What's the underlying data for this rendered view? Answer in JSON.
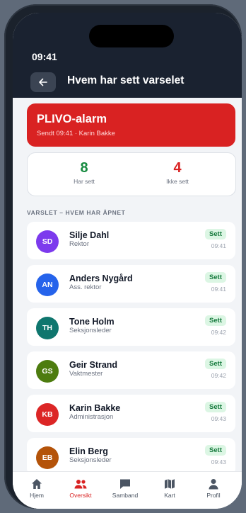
{
  "status_bar": {
    "time": "09:41"
  },
  "header": {
    "title": "Hvem har sett varselet"
  },
  "alarm": {
    "title": "PLIVO-alarm",
    "subtitle": "Sendt 09:41 · Karin Bakke"
  },
  "stats": {
    "seen": {
      "count": "8",
      "label": "Har sett",
      "color": "#168a3f"
    },
    "unseen": {
      "count": "4",
      "label": "Ikke sett",
      "color": "#d92222"
    }
  },
  "section": {
    "label": "VARSLET – HVEM HAR ÅPNET"
  },
  "recipients": [
    {
      "initials": "SD",
      "name": "Silje Dahl",
      "role": "Rektor",
      "status": "Sett",
      "time": "09:41",
      "color": "#7c3aed"
    },
    {
      "initials": "AN",
      "name": "Anders Nygård",
      "role": "Ass. rektor",
      "status": "Sett",
      "time": "09:41",
      "color": "#2563eb"
    },
    {
      "initials": "TH",
      "name": "Tone Holm",
      "role": "Seksjonsleder",
      "status": "Sett",
      "time": "09:42",
      "color": "#0f766e"
    },
    {
      "initials": "GS",
      "name": "Geir Strand",
      "role": "Vaktmester",
      "status": "Sett",
      "time": "09:42",
      "color": "#4d7c0f"
    },
    {
      "initials": "KB",
      "name": "Karin Bakke",
      "role": "Administrasjon",
      "status": "Sett",
      "time": "09:43",
      "color": "#dc2626"
    },
    {
      "initials": "EB",
      "name": "Elin Berg",
      "role": "Seksjonsleder",
      "status": "Sett",
      "time": "09:43",
      "color": "#b45309"
    }
  ],
  "nav": {
    "items": [
      {
        "label": "Hjem",
        "icon": "home-icon"
      },
      {
        "label": "Oversikt",
        "icon": "people-icon",
        "active": true
      },
      {
        "label": "Samband",
        "icon": "chat-icon"
      },
      {
        "label": "Kart",
        "icon": "map-icon"
      },
      {
        "label": "Profil",
        "icon": "person-icon"
      }
    ],
    "active_color": "#d92222"
  }
}
